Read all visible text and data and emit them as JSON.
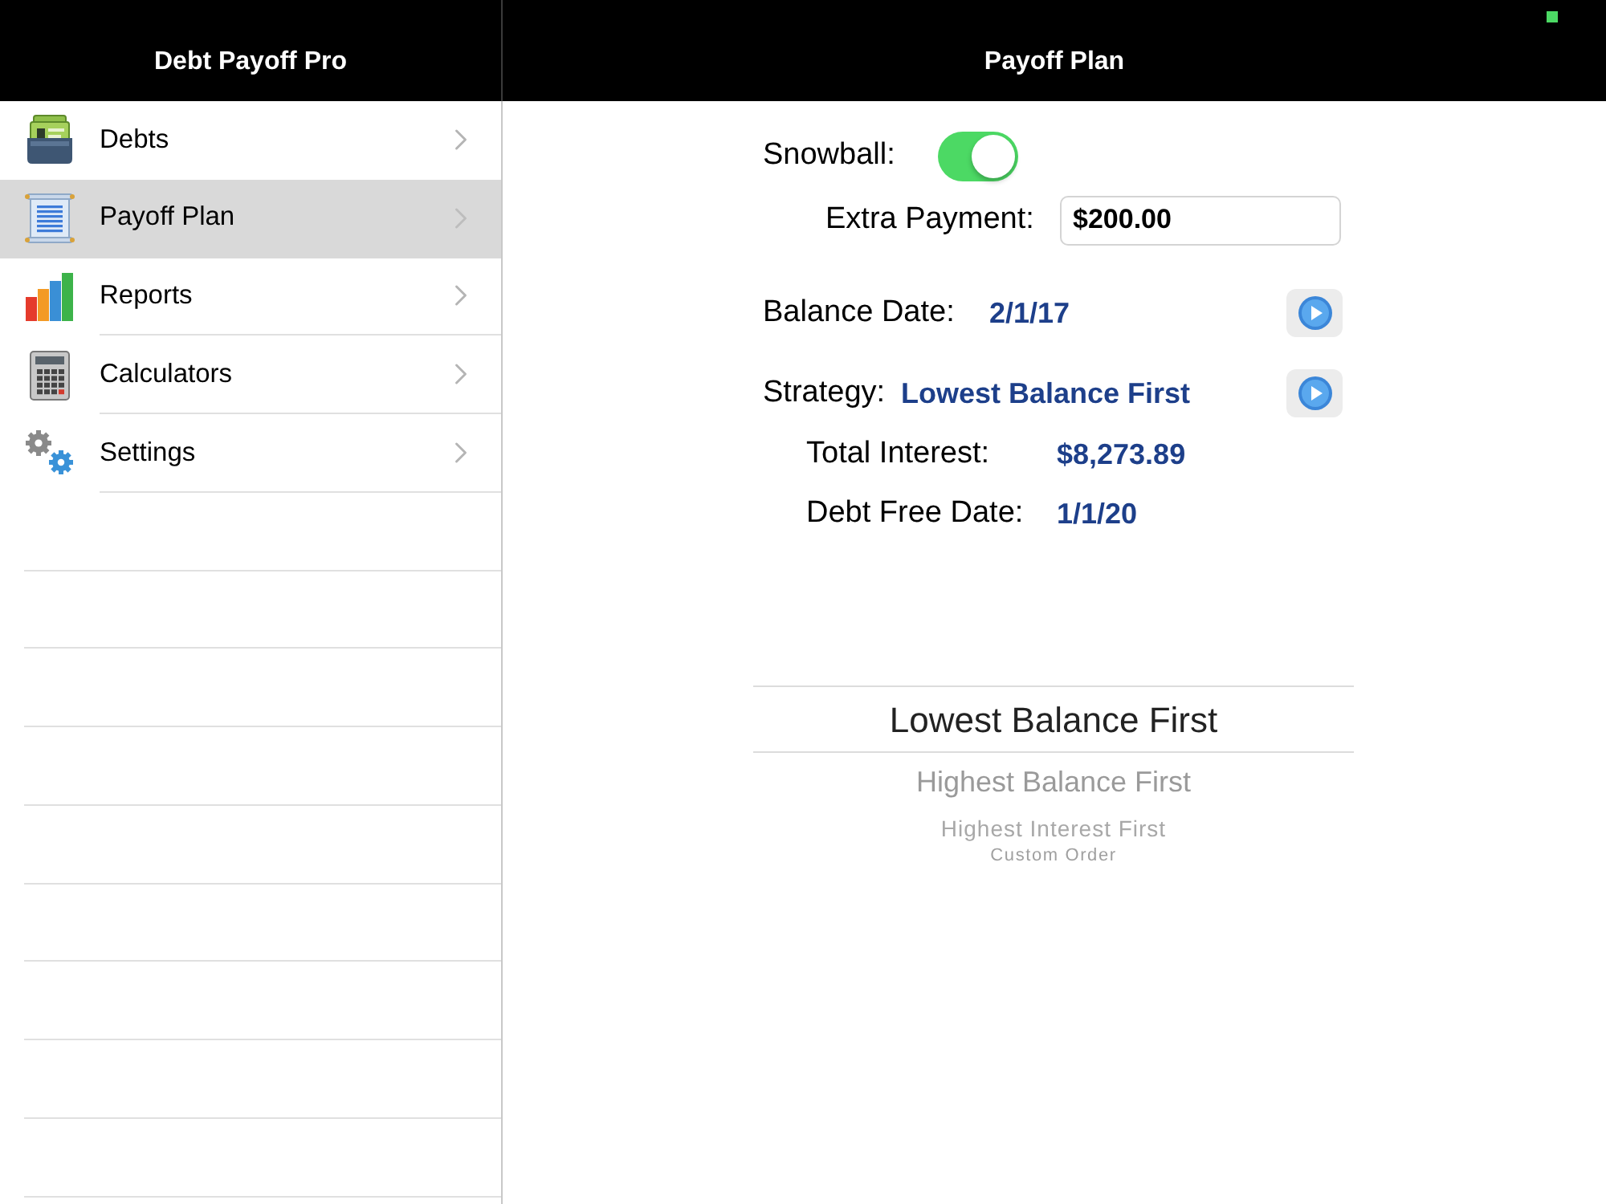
{
  "sidebar": {
    "title": "Debt Payoff Pro",
    "items": [
      {
        "label": "Debts",
        "selected": false
      },
      {
        "label": "Payoff Plan",
        "selected": true
      },
      {
        "label": "Reports",
        "selected": false
      },
      {
        "label": "Calculators",
        "selected": false
      },
      {
        "label": "Settings",
        "selected": false
      }
    ]
  },
  "main": {
    "title": "Payoff Plan",
    "snowball": {
      "label": "Snowball:",
      "on": true
    },
    "extra_payment": {
      "label": "Extra Payment:",
      "value": "$200.00"
    },
    "balance_date": {
      "label": "Balance Date:",
      "value": "2/1/17"
    },
    "strategy": {
      "label": "Strategy:",
      "value": "Lowest Balance First"
    },
    "total_interest": {
      "label": "Total Interest:",
      "value": "$8,273.89"
    },
    "debt_free_date": {
      "label": "Debt Free Date:",
      "value": "1/1/20"
    },
    "picker": {
      "options": [
        {
          "label": "Lowest Balance First",
          "selected": true
        },
        {
          "label": "Highest Balance First",
          "selected": false
        },
        {
          "label": "Highest Interest First",
          "selected": false
        },
        {
          "label": "Custom Order",
          "selected": false
        }
      ]
    }
  }
}
